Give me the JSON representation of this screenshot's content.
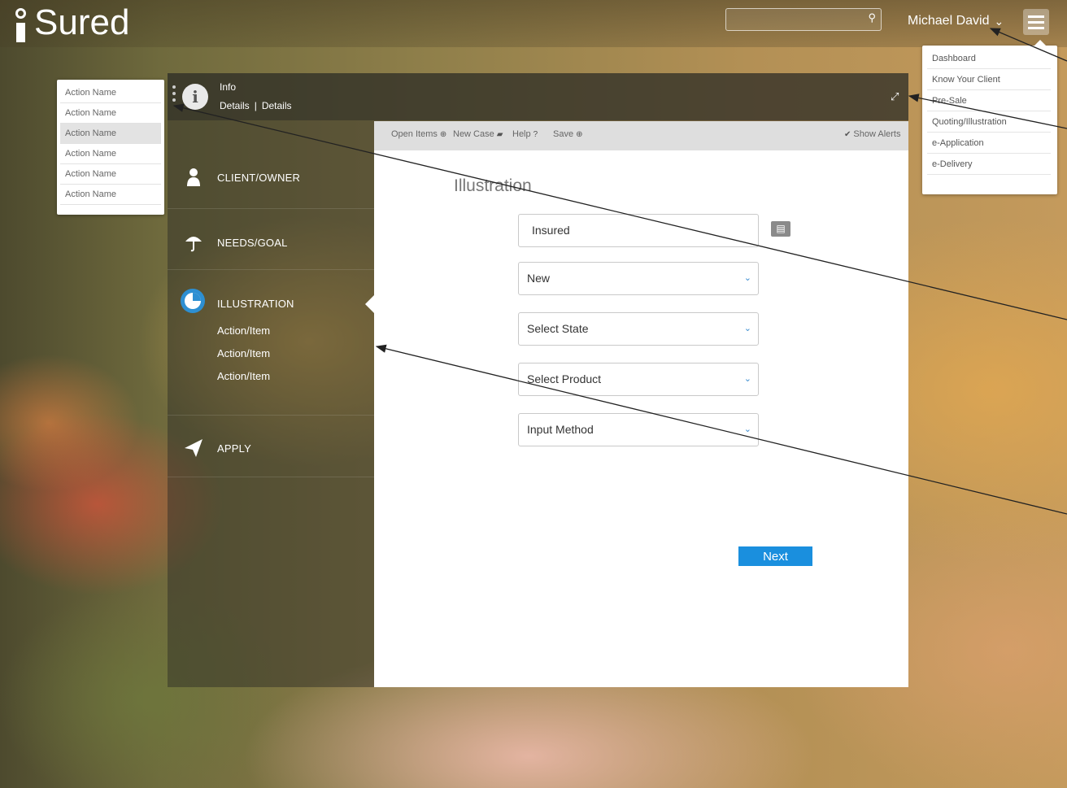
{
  "header": {
    "logo_text": "Sured",
    "search_icon": "⚲",
    "user_name": "Michael David",
    "user_chevron": "⌄"
  },
  "main_menu": {
    "items": [
      "Dashboard",
      "Know Your Client",
      "Pre-Sale",
      "Quoting/Illustration",
      "e-Application",
      "e-Delivery"
    ]
  },
  "action_menu": {
    "items": [
      "Action Name",
      "Action Name",
      "Action Name",
      "Action Name",
      "Action Name",
      "Action Name"
    ],
    "active_index": 2
  },
  "info_bar": {
    "icon": "i",
    "title": "Info",
    "details_1": "Details",
    "separator": "|",
    "details_2": "Details",
    "expand_icon": "⤢"
  },
  "sidebar": {
    "client_owner": "CLIENT/OWNER",
    "needs_goal": "NEEDS/GOAL",
    "illustration": "ILLUSTRATION",
    "sub_items": [
      "Action/Item",
      "Action/Item",
      "Action/Item"
    ],
    "apply": "APPLY"
  },
  "toolbar": {
    "open_items": "Open Items",
    "open_items_icon": "⊕",
    "new_case": "New Case",
    "new_case_icon": "▰",
    "help": "Help",
    "help_icon": "?",
    "save": "Save",
    "save_icon": "⊕",
    "show_alerts_icon": "✔",
    "show_alerts": "Show Alerts"
  },
  "form": {
    "title": "Illustration",
    "insured": "Insured",
    "case_type": "New",
    "state": "Select State",
    "product": "Select Product",
    "input_method": "Input Method",
    "chevron": "⌄",
    "next": "Next"
  },
  "colors": {
    "accent": "#1a8fde",
    "illustration_icon": "#2d8fd2",
    "toolbar_bg": "#dedede"
  }
}
